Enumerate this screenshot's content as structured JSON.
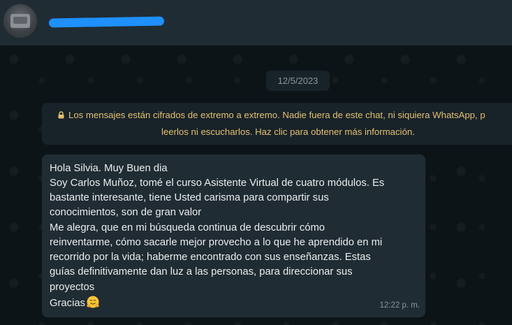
{
  "header": {
    "contact_name_redacted": true
  },
  "chat": {
    "date_label": "12/5/2023",
    "encryption_notice": {
      "line1": "Los mensajes están cifrados de extremo a extremo. Nadie fuera de este chat, ni siquiera WhatsApp, p",
      "line2": "leerlos ni escucharlos. Haz clic para obtener más información.",
      "icon": "lock-icon",
      "color": "#e3c16f"
    },
    "message": {
      "lines": [
        "Hola Silvia. Muy Buen dia",
        "Soy Carlos Muñoz, tomé el curso Asistente Virtual de cuatro módulos. Es",
        "bastante interesante, tiene Usted carisma para compartir sus",
        "conocimientos, son de gran valor",
        "Me alegra, que en mi búsqueda continua de descubrir cómo",
        "reinventarme, cómo sacarle mejor provecho a lo que he aprendido en mi",
        "recorrido por la vida; haberme encontrado con sus enseñanzas. Estas",
        "guías definitivamente dan luz a las personas, para direccionar sus",
        "proyectos",
        "Gracias"
      ],
      "emoji": "hugging-face-emoji",
      "time": "12:22 p. m."
    }
  }
}
